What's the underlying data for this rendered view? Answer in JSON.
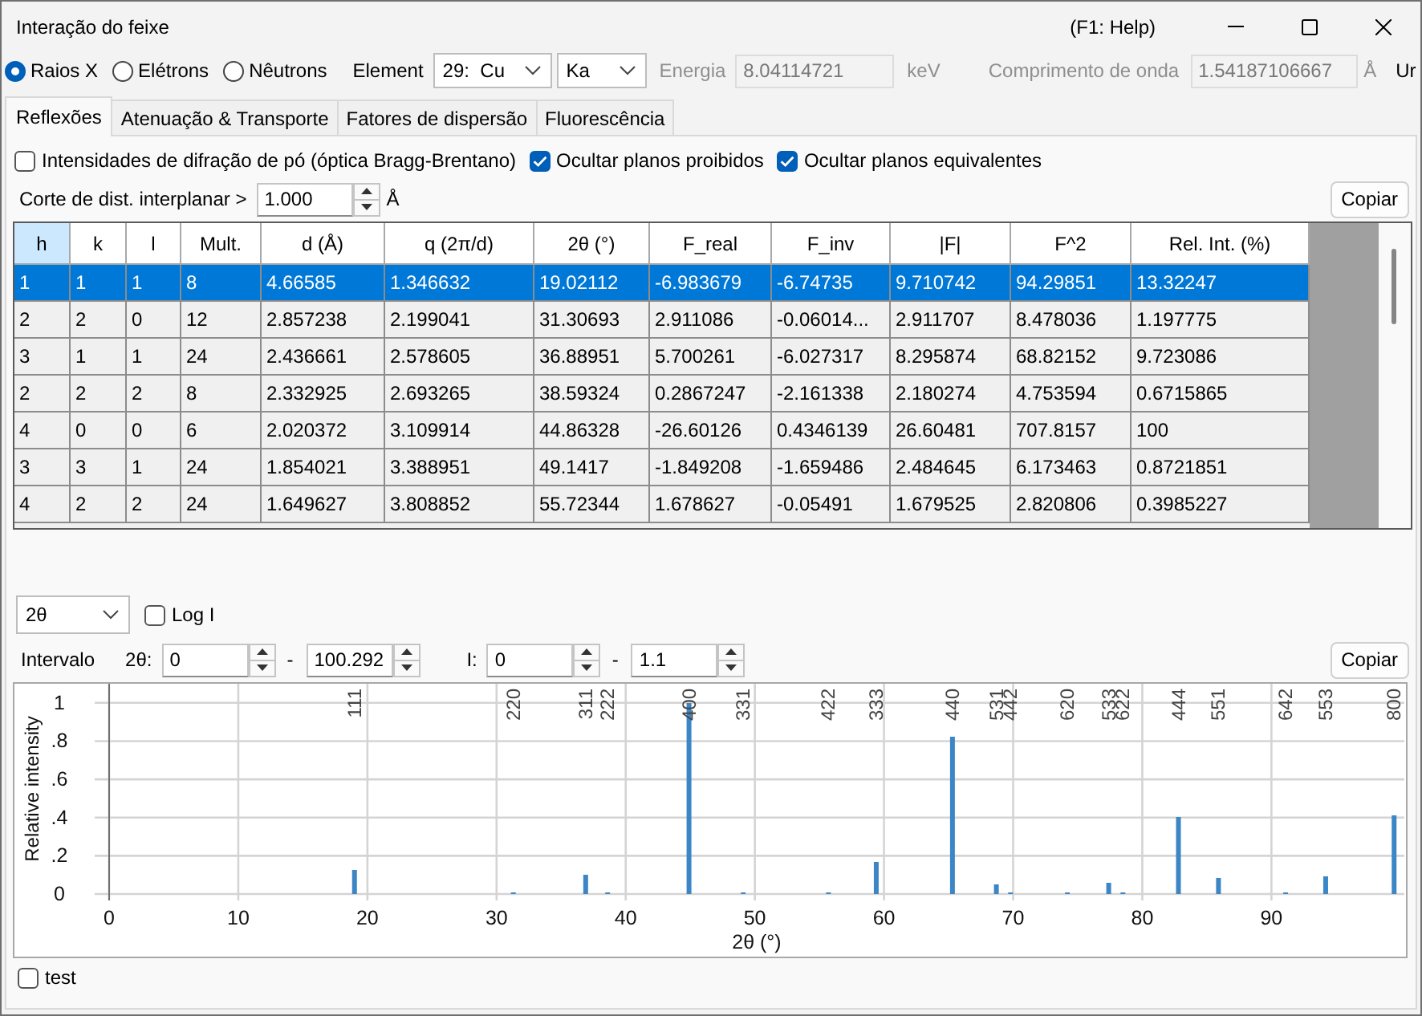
{
  "window": {
    "title": "Interação do feixe",
    "help": "(F1: Help)"
  },
  "source": {
    "radiation": [
      {
        "label": "Raios X",
        "selected": true
      },
      {
        "label": "Elétrons",
        "selected": false
      },
      {
        "label": "Nêutrons",
        "selected": false
      }
    ],
    "element": {
      "label": "Element",
      "value": "29:  Cu"
    },
    "line": "Ka",
    "energy": {
      "label": "Energia",
      "value": "8.04114721",
      "unit": "keV",
      "disabled": true
    },
    "wavelength": {
      "label": "Comprimento de onda",
      "value": "1.54187106667",
      "unit": "Å",
      "disabled": true
    },
    "cut_off_label": "Ur"
  },
  "tabs": [
    {
      "label": "Reflexões",
      "selected": true
    },
    {
      "label": "Atenuação & Transporte",
      "selected": false
    },
    {
      "label": "Fatores de dispersão",
      "selected": false
    },
    {
      "label": "Fluorescência",
      "selected": false
    }
  ],
  "reflections": {
    "options": [
      {
        "label": "Intensidades de difração de pó (óptica Bragg-Brentano)",
        "checked": false
      },
      {
        "label": "Ocultar planos proibidos",
        "checked": true
      },
      {
        "label": "Ocultar planos equivalentes",
        "checked": true
      }
    ],
    "cutoff": {
      "label": "Corte de dist. interplanar >",
      "value": "1.000",
      "unit": "Å"
    },
    "copy_button": "Copiar"
  },
  "table": {
    "columns": [
      {
        "label": "h",
        "selected": true
      },
      {
        "label": "k",
        "selected": false
      },
      {
        "label": "l",
        "selected": false
      },
      {
        "label": "Mult.",
        "selected": false
      },
      {
        "label": "d (Å)",
        "selected": false
      },
      {
        "label": "q (2π/d)",
        "selected": false
      },
      {
        "label": "2θ (°)",
        "selected": false
      },
      {
        "label": "F_real",
        "selected": false
      },
      {
        "label": "F_inv",
        "selected": false
      },
      {
        "label": "|F|",
        "selected": false
      },
      {
        "label": "F^2",
        "selected": false
      },
      {
        "label": "Rel. Int. (%)",
        "selected": false
      }
    ],
    "rows": [
      {
        "selected": true,
        "cells": [
          "1",
          "1",
          "1",
          "8",
          "4.66585",
          "1.346632",
          "19.02112",
          "-6.983679",
          "-6.74735",
          "9.710742",
          "94.29851",
          "13.32247"
        ]
      },
      {
        "selected": false,
        "cells": [
          "2",
          "2",
          "0",
          "12",
          "2.857238",
          "2.199041",
          "31.30693",
          "2.911086",
          "-0.06014...",
          "2.911707",
          "8.478036",
          "1.197775"
        ]
      },
      {
        "selected": false,
        "cells": [
          "3",
          "1",
          "1",
          "24",
          "2.436661",
          "2.578605",
          "36.88951",
          "5.700261",
          "-6.027317",
          "8.295874",
          "68.82152",
          "9.723086"
        ]
      },
      {
        "selected": false,
        "cells": [
          "2",
          "2",
          "2",
          "8",
          "2.332925",
          "2.693265",
          "38.59324",
          "0.2867247",
          "-2.161338",
          "2.180274",
          "4.753594",
          "0.6715865"
        ]
      },
      {
        "selected": false,
        "cells": [
          "4",
          "0",
          "0",
          "6",
          "2.020372",
          "3.109914",
          "44.86328",
          "-26.60126",
          "0.4346139",
          "26.60481",
          "707.8157",
          "100"
        ]
      },
      {
        "selected": false,
        "cells": [
          "3",
          "3",
          "1",
          "24",
          "1.854021",
          "3.388951",
          "49.1417",
          "-1.849208",
          "-1.659486",
          "2.484645",
          "6.173463",
          "0.8721851"
        ]
      },
      {
        "selected": false,
        "cells": [
          "4",
          "2",
          "2",
          "24",
          "1.649627",
          "3.808852",
          "55.72344",
          "1.678627",
          "-0.05491",
          "1.679525",
          "2.820806",
          "0.3985227"
        ]
      }
    ]
  },
  "plot": {
    "axis": "2θ",
    "log": {
      "label": "Log I",
      "checked": false
    },
    "range_label": "Intervalo",
    "x_range": {
      "label": "2θ:",
      "min": "0",
      "separator": "-",
      "max": "100.292"
    },
    "y_range": {
      "label": "I:",
      "min": "0",
      "separator": "-",
      "max": "1.1"
    },
    "copy_button": "Copiar",
    "chart_data": {
      "type": "bar",
      "xlabel": "2θ (°)",
      "ylabel": "Relative intensity",
      "x": [
        19.0,
        31.3,
        36.9,
        38.6,
        44.9,
        49.1,
        55.7,
        59.4,
        65.3,
        68.7,
        69.8,
        74.2,
        77.4,
        78.5,
        82.8,
        85.9,
        91.1,
        94.2,
        99.5
      ],
      "values": [
        0.13,
        0.01,
        0.1,
        0.01,
        1,
        0.01,
        0.01,
        0.17,
        0.82,
        0.05,
        0.01,
        0.01,
        0.06,
        0.01,
        0.4,
        0.08,
        0.01,
        0.09,
        0.41
      ],
      "xlim": [
        0,
        100.292
      ],
      "ylim": [
        0,
        1.1
      ],
      "xticks": [
        0,
        10,
        20,
        30,
        40,
        50,
        60,
        70,
        80,
        90
      ],
      "yticks": [
        0,
        {
          "value": 0.2,
          "label": ".2"
        },
        {
          "value": 0.4,
          "label": ".4"
        },
        {
          "value": 0.6,
          "label": ".6"
        },
        {
          "value": 0.8,
          "label": ".8"
        },
        1
      ],
      "grid": true,
      "annotations": [
        "111",
        "220",
        "311",
        "222",
        "400",
        "331",
        "422",
        "333",
        "440",
        "531",
        "442",
        "620",
        "533",
        "622",
        "444",
        "551",
        "642",
        "553",
        "800"
      ]
    }
  },
  "footer": {
    "test": {
      "label": "test",
      "checked": false
    }
  }
}
